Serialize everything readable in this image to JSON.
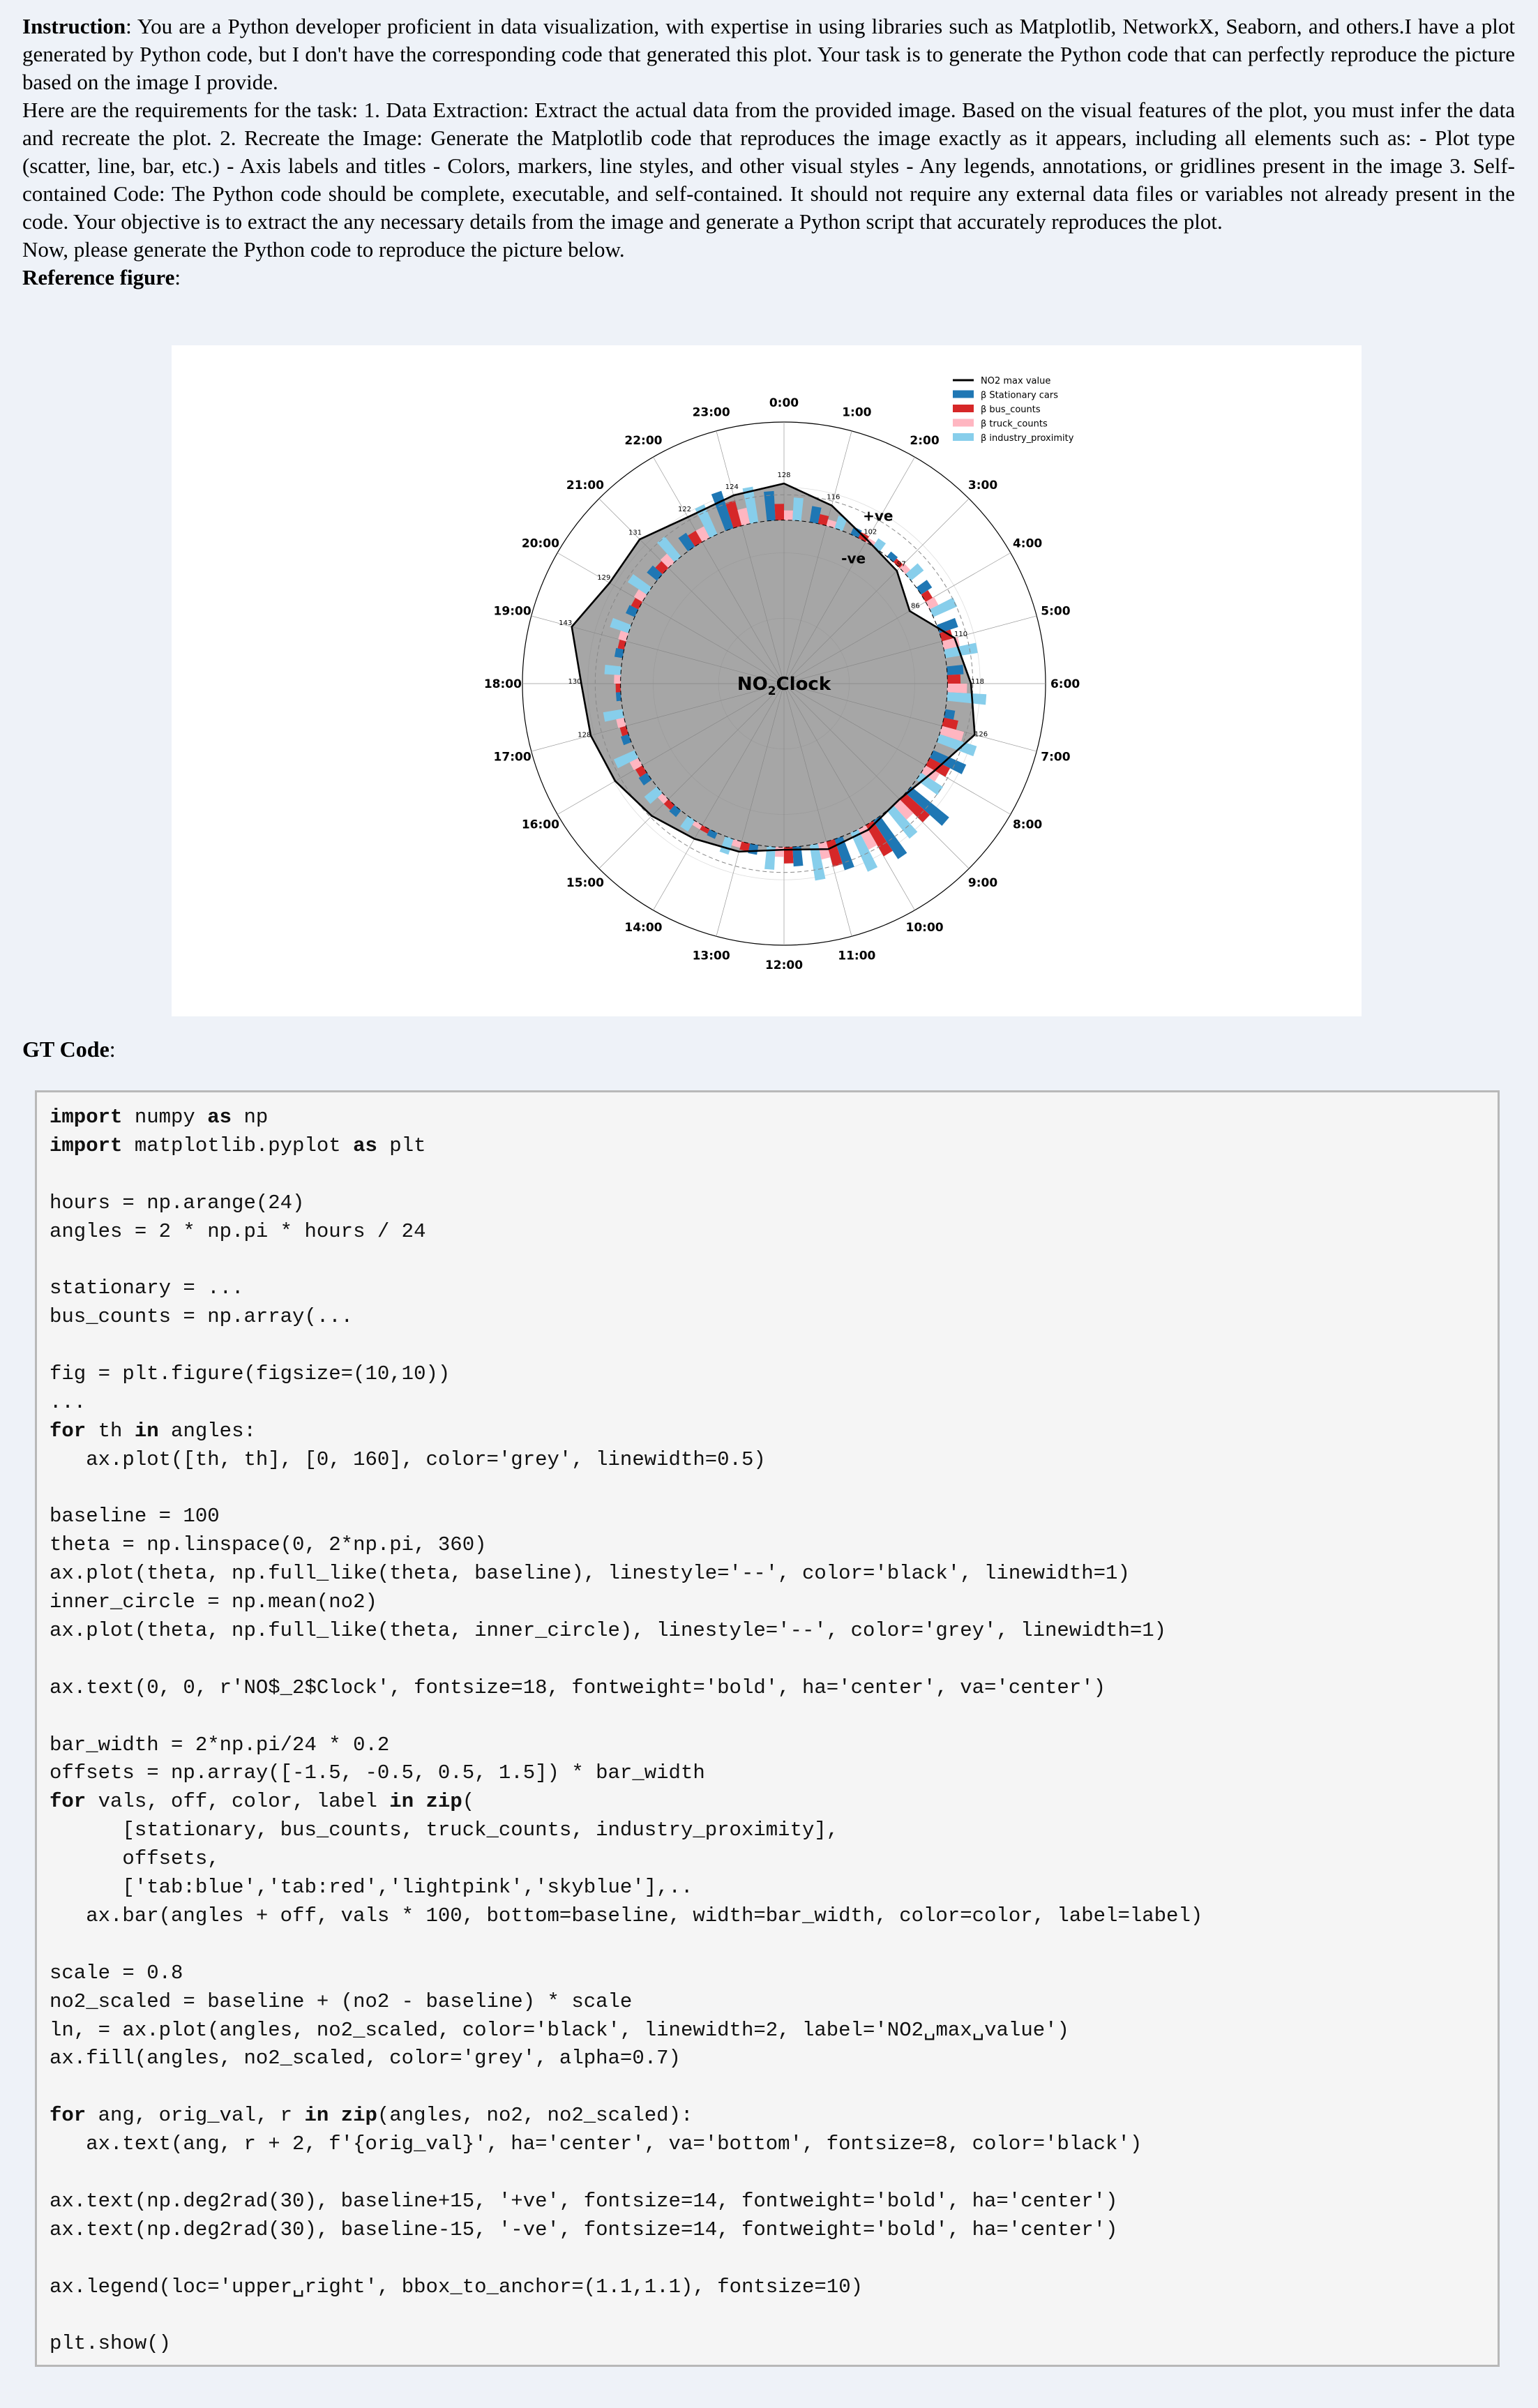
{
  "instruction": {
    "label": "Instruction",
    "text": ": You are a Python developer proficient in data visualization, with expertise in using libraries such as Matplotlib, NetworkX, Seaborn, and others.I have a plot generated by Python code, but I don't have the corresponding code that generated this plot. Your task is to generate the Python code that can perfectly reproduce the picture based on the image I provide.",
    "requirements": "Here are the requirements for the task: 1. Data Extraction: Extract the actual data from the provided image. Based on the visual features of the plot, you must infer the data and recreate the plot. 2. Recreate the Image: Generate the Matplotlib code that reproduces the image exactly as it appears, including all elements such as: - Plot type (scatter, line, bar, etc.) - Axis labels and titles - Colors, markers, line styles, and other visual styles - Any legends, annotations, or gridlines present in the image 3. Self-contained Code: The Python code should be complete, executable, and self-contained. It should not require any external data files or variables not already present in the code. Your objective is to extract the any necessary details from the image and generate a Python script that accurately reproduces the plot.",
    "now": "Now, please generate the Python code to reproduce the picture below.",
    "ref_label": "Reference figure",
    "ref_colon": ":"
  },
  "gt_label": "GT Code",
  "gt_colon": ":",
  "code_lines": [
    "import numpy as np",
    "import matplotlib.pyplot as plt",
    "",
    "hours = np.arange(24)",
    "angles = 2 * np.pi * hours / 24",
    "",
    "stationary = ...",
    "bus_counts = np.array(...",
    "",
    "fig = plt.figure(figsize=(10,10))",
    "...",
    "for th in angles:",
    "   ax.plot([th, th], [0, 160], color='grey', linewidth=0.5)",
    "",
    "baseline = 100",
    "theta = np.linspace(0, 2*np.pi, 360)",
    "ax.plot(theta, np.full_like(theta, baseline), linestyle='--', color='black', linewidth=1)",
    "inner_circle = np.mean(no2)",
    "ax.plot(theta, np.full_like(theta, inner_circle), linestyle='--', color='grey', linewidth=1)",
    "",
    "ax.text(0, 0, r'NO$_2$Clock', fontsize=18, fontweight='bold', ha='center', va='center')",
    "",
    "bar_width = 2*np.pi/24 * 0.2",
    "offsets = np.array([-1.5, -0.5, 0.5, 1.5]) * bar_width",
    "for vals, off, color, label in zip(",
    "      [stationary, bus_counts, truck_counts, industry_proximity],",
    "      offsets,",
    "      ['tab:blue','tab:red','lightpink','skyblue'],..",
    "   ax.bar(angles + off, vals * 100, bottom=baseline, width=bar_width, color=color, label=label)",
    "",
    "scale = 0.8",
    "no2_scaled = baseline + (no2 - baseline) * scale",
    "ln, = ax.plot(angles, no2_scaled, color='black', linewidth=2, label='NO2␣max␣value')",
    "ax.fill(angles, no2_scaled, color='grey', alpha=0.7)",
    "",
    "for ang, orig_val, r in zip(angles, no2, no2_scaled):",
    "   ax.text(ang, r + 2, f'{orig_val}', ha='center', va='bottom', fontsize=8, color='black')",
    "",
    "ax.text(np.deg2rad(30), baseline+15, '+ve', fontsize=14, fontweight='bold', ha='center')",
    "ax.text(np.deg2rad(30), baseline-15, '-ve', fontsize=14, fontweight='bold', ha='center')",
    "",
    "ax.legend(loc='upper␣right', bbox_to_anchor=(1.1,1.1), fontsize=10)",
    "",
    "plt.show()"
  ],
  "chart_data": {
    "type": "polar-bar",
    "title": "NO$_2$Clock",
    "hour_labels": [
      "0:00",
      "1:00",
      "2:00",
      "3:00",
      "4:00",
      "5:00",
      "6:00",
      "7:00",
      "8:00",
      "9:00",
      "10:00",
      "11:00",
      "12:00",
      "13:00",
      "14:00",
      "15:00",
      "16:00",
      "17:00",
      "18:00",
      "19:00",
      "20:00",
      "21:00",
      "22:00",
      "23:00"
    ],
    "baseline": 100,
    "rmax": 160,
    "scale": 0.8,
    "no2": [
      128,
      116,
      102,
      97,
      86,
      110,
      118,
      126,
      108,
      100,
      104,
      106,
      102,
      108,
      112,
      118,
      124,
      128,
      130,
      143,
      129,
      131,
      122,
      124
    ],
    "no2_labels": [
      "128",
      "116",
      "102",
      "97",
      "86",
      "110",
      "118",
      "126",
      "",
      "",
      "",
      "",
      "",
      "",
      "",
      "",
      "",
      "128",
      "130",
      "143",
      "129",
      "131",
      "122",
      "124"
    ],
    "pos_label": "+ve",
    "neg_label": "-ve",
    "series": [
      {
        "name": "β Stationary cars",
        "color": "#1f77b4",
        "values": [
          0.18,
          0.1,
          0.05,
          0.04,
          0.08,
          0.12,
          0.1,
          0.06,
          0.22,
          0.3,
          0.28,
          0.2,
          0.12,
          0.06,
          0.04,
          0.05,
          0.06,
          0.05,
          0.03,
          0.05,
          0.06,
          0.08,
          0.1,
          0.24
        ]
      },
      {
        "name": "β bus_counts",
        "color": "#d62728",
        "values": [
          0.1,
          0.06,
          0.04,
          0.03,
          0.05,
          0.07,
          0.08,
          0.09,
          0.14,
          0.2,
          0.22,
          0.16,
          0.1,
          0.05,
          0.03,
          0.04,
          0.05,
          0.04,
          0.03,
          0.04,
          0.05,
          0.06,
          0.08,
          0.16
        ]
      },
      {
        "name": "β truck_counts",
        "color": "#ffb6c1",
        "values": [
          0.06,
          0.04,
          0.03,
          0.04,
          0.06,
          0.1,
          0.12,
          0.14,
          0.1,
          0.12,
          0.14,
          0.1,
          0.06,
          0.04,
          0.03,
          0.04,
          0.06,
          0.05,
          0.04,
          0.05,
          0.06,
          0.07,
          0.08,
          0.1
        ]
      },
      {
        "name": "β industry_proximity",
        "color": "#87ceeb",
        "values": [
          0.14,
          0.08,
          0.06,
          0.1,
          0.16,
          0.2,
          0.24,
          0.24,
          0.16,
          0.22,
          0.26,
          0.22,
          0.14,
          0.1,
          0.08,
          0.1,
          0.14,
          0.12,
          0.1,
          0.12,
          0.14,
          0.16,
          0.2,
          0.22
        ]
      }
    ],
    "legend": {
      "placement": "top-right",
      "entries": [
        "NO2 max value",
        "β Stationary cars",
        "β bus_counts",
        "β truck_counts",
        "β industry_proximity"
      ]
    }
  }
}
